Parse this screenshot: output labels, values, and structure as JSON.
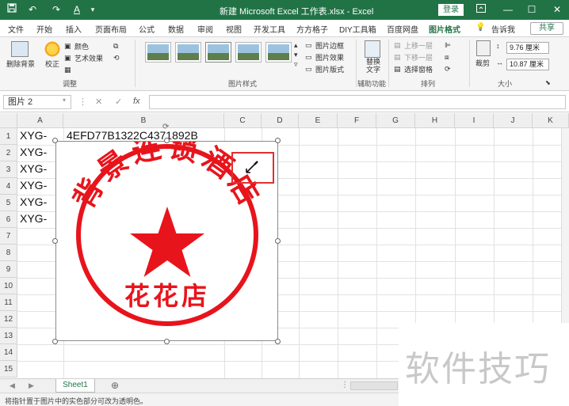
{
  "titlebar": {
    "title": "新建 Microsoft Excel 工作表.xlsx  -  Excel",
    "login": "登录",
    "accent_color": "#217346",
    "qat_icons": [
      "save-icon",
      "undo-icon",
      "redo-icon",
      "font-color-icon",
      "customize-icon"
    ],
    "window_icons": [
      "ribbon-display-icon",
      "minimize-icon",
      "maximize-icon",
      "close-icon"
    ]
  },
  "menu": {
    "items": [
      "文件",
      "开始",
      "插入",
      "页面布局",
      "公式",
      "数据",
      "审阅",
      "视图",
      "开发工具",
      "方方格子",
      "DIY工具箱",
      "百度网盘",
      "图片格式"
    ],
    "active": "图片格式",
    "tell_me": "告诉我",
    "share": "共享"
  },
  "ribbon": {
    "remove_bg": "删除背景",
    "corrections": "校正",
    "color": "颜色",
    "artistic": "艺术效果",
    "adjust_group": "调整",
    "picture_styles_group": "图片样式",
    "border": "图片边框",
    "effects": "图片效果",
    "layout": "图片版式",
    "alt_text": "替换\n文字",
    "accessibility_group": "辅助功能",
    "bring_forward": "上移一层",
    "send_backward": "下移一层",
    "selection_pane": "选择窗格",
    "arrange_group": "排列",
    "crop": "裁剪",
    "height": "9.76 厘米",
    "width": "10.87 厘米",
    "size_group": "大小"
  },
  "formula_bar": {
    "name_box": "图片 2",
    "fx": "fx",
    "content": ""
  },
  "grid": {
    "columns": [
      "A",
      "B",
      "C",
      "D",
      "E",
      "F",
      "G",
      "H",
      "I",
      "J",
      "K"
    ],
    "rows": [
      "1",
      "2",
      "3",
      "4",
      "5",
      "6",
      "7",
      "8",
      "9",
      "10",
      "11",
      "12",
      "13",
      "14",
      "15"
    ],
    "cells": {
      "A1": "XYG-",
      "B1": "4EFD77B1322C4371892B",
      "A2": "XYG-",
      "A3": "XYG-",
      "A4": "XYG-",
      "A5": "XYG-",
      "A6": "XYG-"
    }
  },
  "stamp": {
    "ring_text": "背景连锁酒店",
    "bottom_text": "花花店",
    "color": "#e8141c"
  },
  "sheets": {
    "tabs": [
      "Sheet1"
    ],
    "active": "Sheet1"
  },
  "status": {
    "text": "将指针置于图片中的实色部分可改为透明色。"
  },
  "watermark": {
    "text": "软件技巧"
  }
}
